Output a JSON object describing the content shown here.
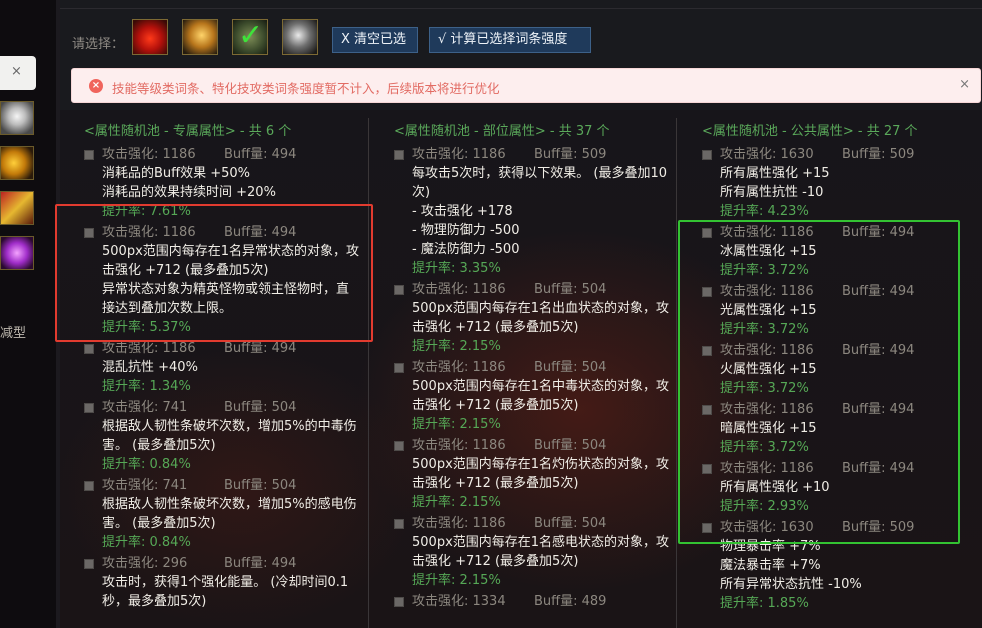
{
  "left": {
    "tab_close": "×",
    "type_label": "减型"
  },
  "toolbar": {
    "select_label": "请选择：",
    "icons": [
      "helmet-icon",
      "shoulder-icon",
      "belt-icon",
      "bracer-icon"
    ],
    "clear_label": "X 清空已选",
    "calc_label": "√ 计算已选择词条强度"
  },
  "alert": {
    "message": "技能等级类词条、特化技攻类词条强度暂不计入，后续版本将进行优化",
    "close": "×"
  },
  "columns": [
    {
      "header": "<属性随机池 - 专属属性> - 共 6 个",
      "entries": [
        {
          "atk": "攻击强化: 1186",
          "buff": "Buff量: 494",
          "effect": [
            "消耗品的Buff效果 +50%",
            "消耗品的效果持续时间 +20%"
          ],
          "rate": "提升率: 7.61%"
        },
        {
          "atk": "攻击强化: 1186",
          "buff": "Buff量: 494",
          "effect": [
            "500px范围内每存在1名异常状态的对象，攻击强化 +712 (最多叠加5次)",
            "异常状态对象为精英怪物或领主怪物时，直接达到叠加次数上限。"
          ],
          "rate": "提升率: 5.37%"
        },
        {
          "atk": "攻击强化: 1186",
          "buff": "Buff量: 494",
          "effect": [
            "混乱抗性 +40%"
          ],
          "rate": "提升率: 1.34%"
        },
        {
          "atk": "攻击强化: 741",
          "buff": "Buff量: 504",
          "effect": [
            "根据敌人韧性条破坏次数，增加5%的中毒伤害。 (最多叠加5次)"
          ],
          "rate": "提升率: 0.84%"
        },
        {
          "atk": "攻击强化: 741",
          "buff": "Buff量: 504",
          "effect": [
            "根据敌人韧性条破坏次数，增加5%的感电伤害。 (最多叠加5次)"
          ],
          "rate": "提升率: 0.84%"
        },
        {
          "atk": "攻击强化: 296",
          "buff": "Buff量: 494",
          "effect": [
            "攻击时，获得1个强化能量。 (冷却时间0.1秒，最多叠加5次)"
          ],
          "rate": ""
        }
      ]
    },
    {
      "header": "<属性随机池 - 部位属性> - 共 37 个",
      "entries": [
        {
          "atk": "攻击强化: 1186",
          "buff": "Buff量: 509",
          "effect": [
            "每攻击5次时，获得以下效果。 (最多叠加10次)",
            "- 攻击强化 +178",
            "- 物理防御力 -500",
            "- 魔法防御力 -500"
          ],
          "rate": "提升率: 3.35%"
        },
        {
          "atk": "攻击强化: 1186",
          "buff": "Buff量: 504",
          "effect": [
            "500px范围内每存在1名出血状态的对象，攻击强化 +712 (最多叠加5次)"
          ],
          "rate": "提升率: 2.15%"
        },
        {
          "atk": "攻击强化: 1186",
          "buff": "Buff量: 504",
          "effect": [
            "500px范围内每存在1名中毒状态的对象，攻击强化 +712 (最多叠加5次)"
          ],
          "rate": "提升率: 2.15%"
        },
        {
          "atk": "攻击强化: 1186",
          "buff": "Buff量: 504",
          "effect": [
            "500px范围内每存在1名灼伤状态的对象，攻击强化 +712 (最多叠加5次)"
          ],
          "rate": "提升率: 2.15%"
        },
        {
          "atk": "攻击强化: 1186",
          "buff": "Buff量: 504",
          "effect": [
            "500px范围内每存在1名感电状态的对象，攻击强化 +712 (最多叠加5次)"
          ],
          "rate": "提升率: 2.15%"
        },
        {
          "atk": "攻击强化: 1334",
          "buff": "Buff量: 489",
          "effect": [],
          "rate": ""
        }
      ]
    },
    {
      "header": "<属性随机池 - 公共属性> - 共 27 个",
      "entries": [
        {
          "atk": "攻击强化: 1630",
          "buff": "Buff量: 509",
          "effect": [
            "所有属性强化 +15",
            "所有属性抗性 -10"
          ],
          "rate": "提升率: 4.23%"
        },
        {
          "atk": "攻击强化: 1186",
          "buff": "Buff量: 494",
          "effect": [
            "冰属性强化 +15"
          ],
          "rate": "提升率: 3.72%"
        },
        {
          "atk": "攻击强化: 1186",
          "buff": "Buff量: 494",
          "effect": [
            "光属性强化 +15"
          ],
          "rate": "提升率: 3.72%"
        },
        {
          "atk": "攻击强化: 1186",
          "buff": "Buff量: 494",
          "effect": [
            "火属性强化 +15"
          ],
          "rate": "提升率: 3.72%"
        },
        {
          "atk": "攻击强化: 1186",
          "buff": "Buff量: 494",
          "effect": [
            "暗属性强化 +15"
          ],
          "rate": "提升率: 3.72%"
        },
        {
          "atk": "攻击强化: 1186",
          "buff": "Buff量: 494",
          "effect": [
            "所有属性强化 +10"
          ],
          "rate": "提升率: 2.93%"
        },
        {
          "atk": "攻击强化: 1630",
          "buff": "Buff量: 509",
          "effect": [
            "物理暴击率 +7%",
            "魔法暴击率 +7%",
            "所有异常状态抗性 -10%"
          ],
          "rate": "提升率: 1.85%"
        }
      ]
    }
  ],
  "highlight_colors": {
    "red": "#e23b2f",
    "green": "#33c232"
  }
}
